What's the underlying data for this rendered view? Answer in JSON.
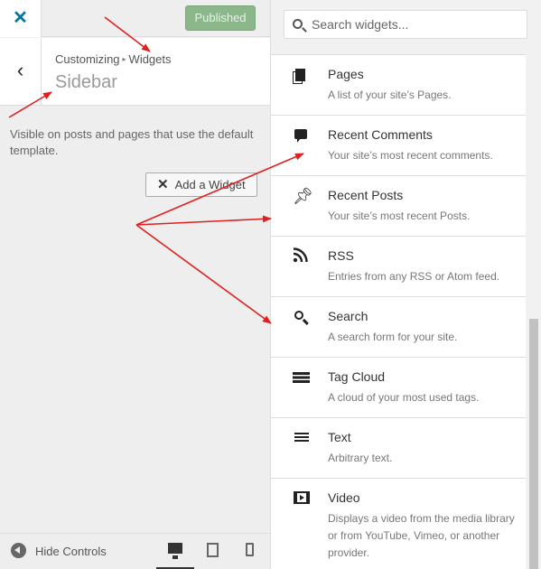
{
  "topbar": {
    "close_icon": "close-icon",
    "publish_label": "Published"
  },
  "section": {
    "back_icon": "chevron-left-icon",
    "breadcrumb_parent": "Customizing",
    "breadcrumb_current": "Widgets",
    "title": "Sidebar",
    "description": "Visible on posts and pages that use the default template.",
    "add_widget_label": "Add a Widget"
  },
  "footer": {
    "hide_label": "Hide Controls",
    "devices": [
      "desktop",
      "tablet",
      "mobile"
    ],
    "active_device": "desktop"
  },
  "widget_search": {
    "placeholder": "Search widgets..."
  },
  "widgets": [
    {
      "icon": "pages-icon",
      "title": "Pages",
      "description": "A list of your site’s Pages."
    },
    {
      "icon": "comment-icon",
      "title": "Recent Comments",
      "description": "Your site’s most recent comments."
    },
    {
      "icon": "pin-icon",
      "title": "Recent Posts",
      "description": "Your site’s most recent Posts."
    },
    {
      "icon": "rss-icon",
      "title": "RSS",
      "description": "Entries from any RSS or Atom feed."
    },
    {
      "icon": "search-icon",
      "title": "Search",
      "description": "A search form for your site."
    },
    {
      "icon": "tag-cloud-icon",
      "title": "Tag Cloud",
      "description": "A cloud of your most used tags."
    },
    {
      "icon": "text-icon",
      "title": "Text",
      "description": "Arbitrary text."
    },
    {
      "icon": "video-icon",
      "title": "Video",
      "description": "Displays a video from the media library or from YouTube, Vimeo, or another provider."
    }
  ],
  "colors": {
    "accent": "#0073aa",
    "published_bg": "#8bb78b",
    "annotation_arrow": "#e02020"
  }
}
